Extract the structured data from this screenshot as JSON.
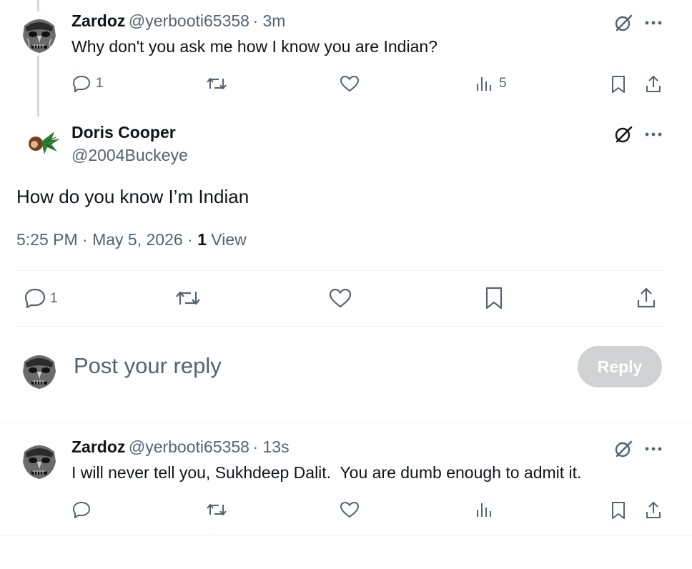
{
  "tweet1": {
    "name": "Zardoz",
    "handle": "@yerbooti65358",
    "time": "· 3m",
    "text": "Why don't you ask me how I know you are Indian?",
    "reply_count": "1",
    "view_count": "5"
  },
  "main_tweet": {
    "name": "Doris Cooper",
    "handle": "@2004Buckeye",
    "text": "How do you know I’m Indian",
    "timestamp": "5:25 PM · May 5, 2026 · ",
    "views_count": "1",
    "views_label": " View",
    "reply_count": "1"
  },
  "composer": {
    "placeholder": "Post your reply",
    "reply_label": "Reply"
  },
  "tweet3": {
    "name": "Zardoz",
    "handle": "@yerbooti65358",
    "time": "· 13s",
    "text": "I will never tell you, Sukhdeep Dalit.  You are dumb enough to admit it."
  },
  "icons": {
    "more": "more-icon",
    "grok": "grok-icon",
    "reply": "reply-icon",
    "repost": "repost-icon",
    "like": "like-icon",
    "views": "views-icon",
    "bookmark": "bookmark-icon",
    "share": "share-icon"
  },
  "colors": {
    "text_primary": "#0f1419",
    "text_secondary": "#536471",
    "divider": "#eff3f4",
    "reply_disabled": "#d0d2d4"
  }
}
